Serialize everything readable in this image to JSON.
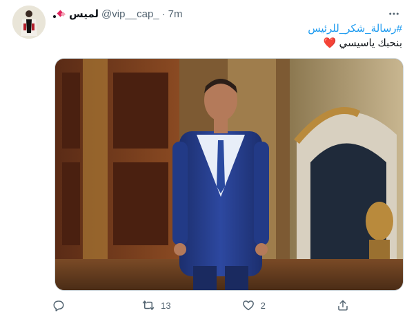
{
  "tweet": {
    "author_name": "لميس",
    "handle": "@vip__cap_",
    "separator": "·",
    "time": "7m",
    "hashtag": "#رسالة_شكر_للرئيس",
    "text": "بنحبك ياسيسي",
    "heart_emoji": "❤️",
    "replies": "",
    "retweets": "13",
    "likes": "2"
  },
  "colors": {
    "accent": "#1d9bf0",
    "secondary_text": "#536471",
    "heart": "#e0245e"
  },
  "icons": {
    "more": "more-icon",
    "reply": "reply-icon",
    "retweet": "retweet-icon",
    "like": "heart-icon",
    "share": "share-icon"
  }
}
